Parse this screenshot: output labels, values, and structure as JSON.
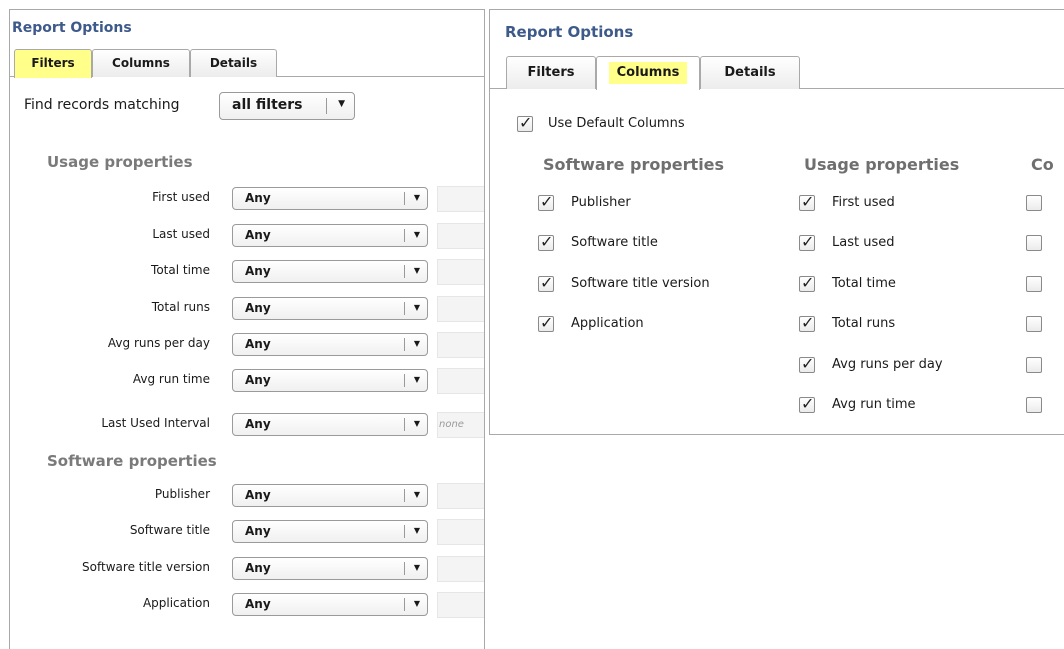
{
  "left_panel": {
    "title": "Report Options",
    "tabs": [
      {
        "label": "Filters",
        "active": true
      },
      {
        "label": "Columns",
        "active": false
      },
      {
        "label": "Details",
        "active": false
      }
    ],
    "match_label": "Find records matching",
    "match_value": "all filters",
    "sections": [
      {
        "heading": "Usage properties",
        "rows": [
          {
            "label": "First used",
            "value": "Any",
            "extra": ""
          },
          {
            "label": "Last used",
            "value": "Any",
            "extra": ""
          },
          {
            "label": "Total time",
            "value": "Any",
            "extra": ""
          },
          {
            "label": "Total runs",
            "value": "Any",
            "extra": ""
          },
          {
            "label": "Avg runs per day",
            "value": "Any",
            "extra": ""
          },
          {
            "label": "Avg run time",
            "value": "Any",
            "extra": ""
          },
          {
            "label": "Last Used Interval",
            "value": "Any",
            "extra": "none"
          }
        ]
      },
      {
        "heading": "Software properties",
        "rows": [
          {
            "label": "Publisher",
            "value": "Any",
            "extra": ""
          },
          {
            "label": "Software title",
            "value": "Any",
            "extra": ""
          },
          {
            "label": "Software title version",
            "value": "Any",
            "extra": ""
          },
          {
            "label": "Application",
            "value": "Any",
            "extra": ""
          }
        ]
      }
    ]
  },
  "right_panel": {
    "title": "Report Options",
    "tabs": [
      {
        "label": "Filters",
        "active": false
      },
      {
        "label": "Columns",
        "active": true
      },
      {
        "label": "Details",
        "active": false
      }
    ],
    "use_default": {
      "label": "Use Default Columns",
      "checked": true
    },
    "columns": [
      {
        "heading": "Software properties",
        "items": [
          {
            "label": "Publisher",
            "checked": true
          },
          {
            "label": "Software title",
            "checked": true
          },
          {
            "label": "Software title version",
            "checked": true
          },
          {
            "label": "Application",
            "checked": true
          }
        ]
      },
      {
        "heading": "Usage properties",
        "items": [
          {
            "label": "First used",
            "checked": true
          },
          {
            "label": "Last used",
            "checked": true
          },
          {
            "label": "Total time",
            "checked": true
          },
          {
            "label": "Total runs",
            "checked": true
          },
          {
            "label": "Avg runs per day",
            "checked": true
          },
          {
            "label": "Avg run time",
            "checked": true
          }
        ]
      },
      {
        "heading": "Co",
        "items": [
          {
            "label": "",
            "checked": false
          },
          {
            "label": "",
            "checked": false
          },
          {
            "label": "",
            "checked": false
          },
          {
            "label": "",
            "checked": false
          },
          {
            "label": "",
            "checked": false
          },
          {
            "label": "",
            "checked": false
          }
        ]
      }
    ]
  },
  "glyphs": {
    "dropdown_arrow": "▼",
    "check": "✓"
  },
  "colors": {
    "title": "#3d5a8a",
    "active_tab_highlight": "#ffff8a",
    "section_heading": "#7a7a7a",
    "border": "#a9a9a9"
  }
}
